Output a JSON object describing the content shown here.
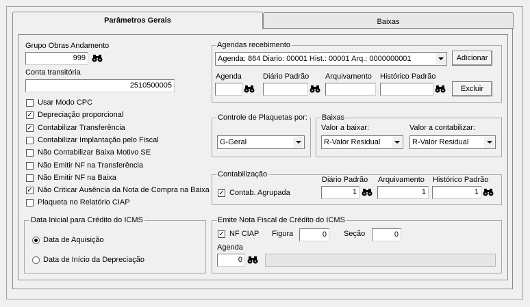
{
  "tabs": {
    "active": "Parâmetros Gerais",
    "inactive": "Baixas"
  },
  "left": {
    "grupo_obras_label": "Grupo Obras Andamento",
    "grupo_obras_value": "999",
    "conta_transitoria_label": "Conta transitória",
    "conta_transitoria_value": "2510500005",
    "checkboxes": [
      {
        "label": "Usar Modo CPC",
        "checked": false
      },
      {
        "label": "Depreciação proporcional",
        "checked": true
      },
      {
        "label": "Contabilizar Transferência",
        "checked": true
      },
      {
        "label": "Contabilizar Implantação pelo Fiscal",
        "checked": false
      },
      {
        "label": "Não Contabilizar Baixa Motivo SE",
        "checked": false
      },
      {
        "label": "Não Emitir NF na Transferência",
        "checked": false
      },
      {
        "label": "Não Emitir NF na Baixa",
        "checked": false
      },
      {
        "label": "Não Criticar Ausência da Nota de Compra na Baixa",
        "checked": true
      },
      {
        "label": "Plaqueta no Relatório CIAP",
        "checked": false
      }
    ],
    "icms_group": {
      "title": "Data Inicial para Crédito do ICMS",
      "option1": "Data de Aquisição",
      "option2": "Data de Início da Depreciação",
      "selected": "Data de Aquisição"
    }
  },
  "agendas": {
    "title": "Agendas recebimento",
    "selected": "Agenda: 864 Diario: 00001 Hist.: 00001 Arq.: 0000000001",
    "add_button": "Adicionar",
    "delete_button": "Excluir",
    "agenda_label": "Agenda",
    "diario_label": "Diário Padrão",
    "arquivamento_label": "Arquivamento",
    "historico_label": "Histórico Padrão"
  },
  "plaquetas": {
    "title": "Controle de Plaquetas por:",
    "value": "G-Geral"
  },
  "baixas": {
    "title": "Baixas",
    "valor_baixar_label": "Valor a baixar:",
    "valor_baixar_value": "R-Valor Residual",
    "valor_contab_label": "Valor a contabilizar:",
    "valor_contab_value": "R-Valor Residual"
  },
  "contabilizacao": {
    "title": "Contabilização",
    "agrupada_label": "Contab. Agrupada",
    "agrupada_checked": true,
    "diario_label": "Diário Padrão",
    "diario_value": "1",
    "arquivamento_label": "Arquivamento",
    "arquivamento_value": "1",
    "historico_label": "Histórico Padrão",
    "historico_value": "1"
  },
  "nota_icms": {
    "title": "Emite Nota Fiscal de Crédito do ICMS",
    "nf_ciap_label": "NF CIAP",
    "nf_ciap_checked": true,
    "figura_label": "Figura",
    "figura_value": "0",
    "secao_label": "Seção",
    "secao_value": "0",
    "agenda_label": "Agenda",
    "agenda_value": "0"
  },
  "icons": {
    "lookup": "binoculars-icon"
  }
}
